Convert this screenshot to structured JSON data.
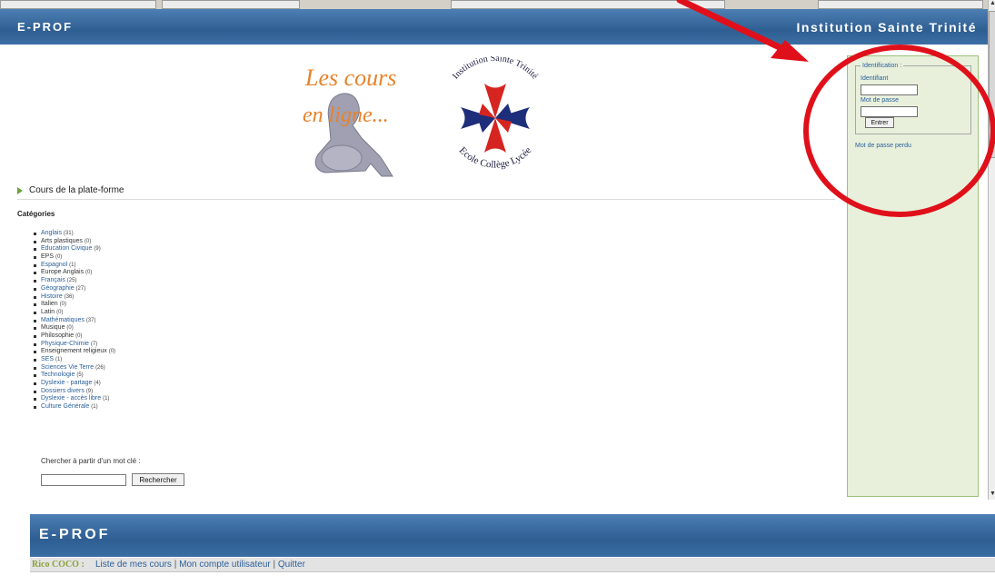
{
  "header": {
    "brand": "E-PROF",
    "institution": "Institution Sainte Trinité"
  },
  "logo": {
    "tagline_line1": "Les cours",
    "tagline_line2": "en ligne...",
    "seal_top": "Institution Sainte Trinité",
    "seal_bottom": "Ecole Collège Lycée",
    "colors": {
      "tagline": "#e8822a",
      "cross_red": "#d62420",
      "cross_blue": "#1d2e7a"
    }
  },
  "section": {
    "title": "Cours de la plate-forme"
  },
  "categories": {
    "title": "Catégories",
    "items": [
      {
        "name": "Anglais",
        "count": "(31)",
        "link": true
      },
      {
        "name": "Arts plastiques",
        "count": "(0)",
        "link": false
      },
      {
        "name": "Education Civique",
        "count": "(9)",
        "link": true
      },
      {
        "name": "EPS",
        "count": "(0)",
        "link": false
      },
      {
        "name": "Espagnol",
        "count": "(1)",
        "link": true
      },
      {
        "name": "Europe Anglais",
        "count": "(0)",
        "link": false
      },
      {
        "name": "Français",
        "count": "(25)",
        "link": true
      },
      {
        "name": "Géographie",
        "count": "(27)",
        "link": true
      },
      {
        "name": "Histoire",
        "count": "(36)",
        "link": true
      },
      {
        "name": "Italien",
        "count": "(0)",
        "link": false
      },
      {
        "name": "Latin",
        "count": "(0)",
        "link": false
      },
      {
        "name": "Mathématiques",
        "count": "(37)",
        "link": true
      },
      {
        "name": "Musique",
        "count": "(0)",
        "link": false
      },
      {
        "name": "Philosophie",
        "count": "(0)",
        "link": false
      },
      {
        "name": "Physique-Chimie",
        "count": "(7)",
        "link": true
      },
      {
        "name": "Enseignement religieux",
        "count": "(0)",
        "link": false
      },
      {
        "name": "SES",
        "count": "(1)",
        "link": true
      },
      {
        "name": "Sciences Vie Terre",
        "count": "(26)",
        "link": true
      },
      {
        "name": "Technologie",
        "count": "(5)",
        "link": true
      },
      {
        "name": "Dyslexie - partage",
        "count": "(4)",
        "link": true
      },
      {
        "name": "Dossiers divers",
        "count": "(9)",
        "link": true
      },
      {
        "name": "Dyslexie - accès libre",
        "count": "(1)",
        "link": true
      },
      {
        "name": "Culture Générale",
        "count": "(1)",
        "link": true
      }
    ]
  },
  "search": {
    "label": "Chercher à partir d'un mot clé :",
    "button": "Rechercher",
    "value": ""
  },
  "login": {
    "legend": "Identification :",
    "username_label": "Identifiant",
    "password_label": "Mot de passe",
    "submit": "Entrer",
    "forgot": "Mot de passe perdu"
  },
  "frame2": {
    "brand": "E-PROF",
    "user": "Rico COCO :",
    "links": [
      "Liste de mes cours",
      "Mon compte utilisateur",
      "Quitter"
    ],
    "separator": "|"
  },
  "annotation_color": "#e0101a"
}
